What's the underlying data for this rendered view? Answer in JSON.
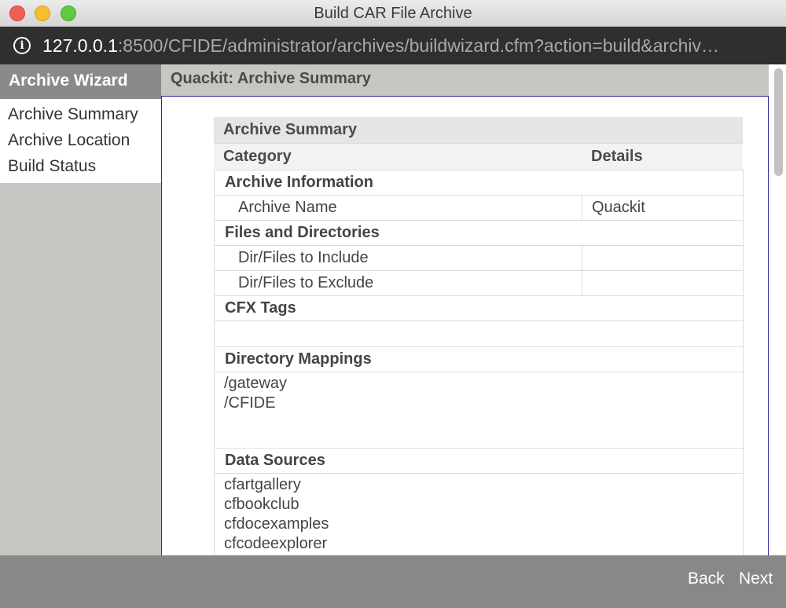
{
  "window": {
    "title": "Build CAR File Archive"
  },
  "address": {
    "host": "127.0.0.1",
    "rest": ":8500/CFIDE/administrator/archives/buildwizard.cfm?action=build&archiv…"
  },
  "sidebar": {
    "header": "Archive Wizard",
    "items": [
      {
        "label": "Archive Summary"
      },
      {
        "label": "Archive Location"
      },
      {
        "label": "Build Status"
      }
    ]
  },
  "main": {
    "header": "Quackit: Archive Summary",
    "summary": {
      "title": "Archive Summary",
      "col_category": "Category",
      "col_details": "Details",
      "sections": {
        "archive_info": "Archive Information",
        "archive_name_label": "Archive Name",
        "archive_name_value": "Quackit",
        "files_dirs": "Files and Directories",
        "include_label": "Dir/Files to Include",
        "include_value": "",
        "exclude_label": "Dir/Files to Exclude",
        "exclude_value": "",
        "cfx_tags": "CFX Tags",
        "dir_mappings": "Directory Mappings",
        "mappings": [
          "/gateway",
          "/CFIDE"
        ],
        "data_sources": "Data Sources",
        "datasources": [
          "cfartgallery",
          "cfbookclub",
          "cfdocexamples",
          "cfcodeexplorer"
        ]
      }
    }
  },
  "footer": {
    "back": "Back",
    "next": "Next"
  },
  "colors": {
    "sidebar_bg": "#c6c6c2",
    "sidebar_header_bg": "#8a8a8a",
    "footer_bg": "#888888",
    "content_border": "#2b2b9e"
  }
}
